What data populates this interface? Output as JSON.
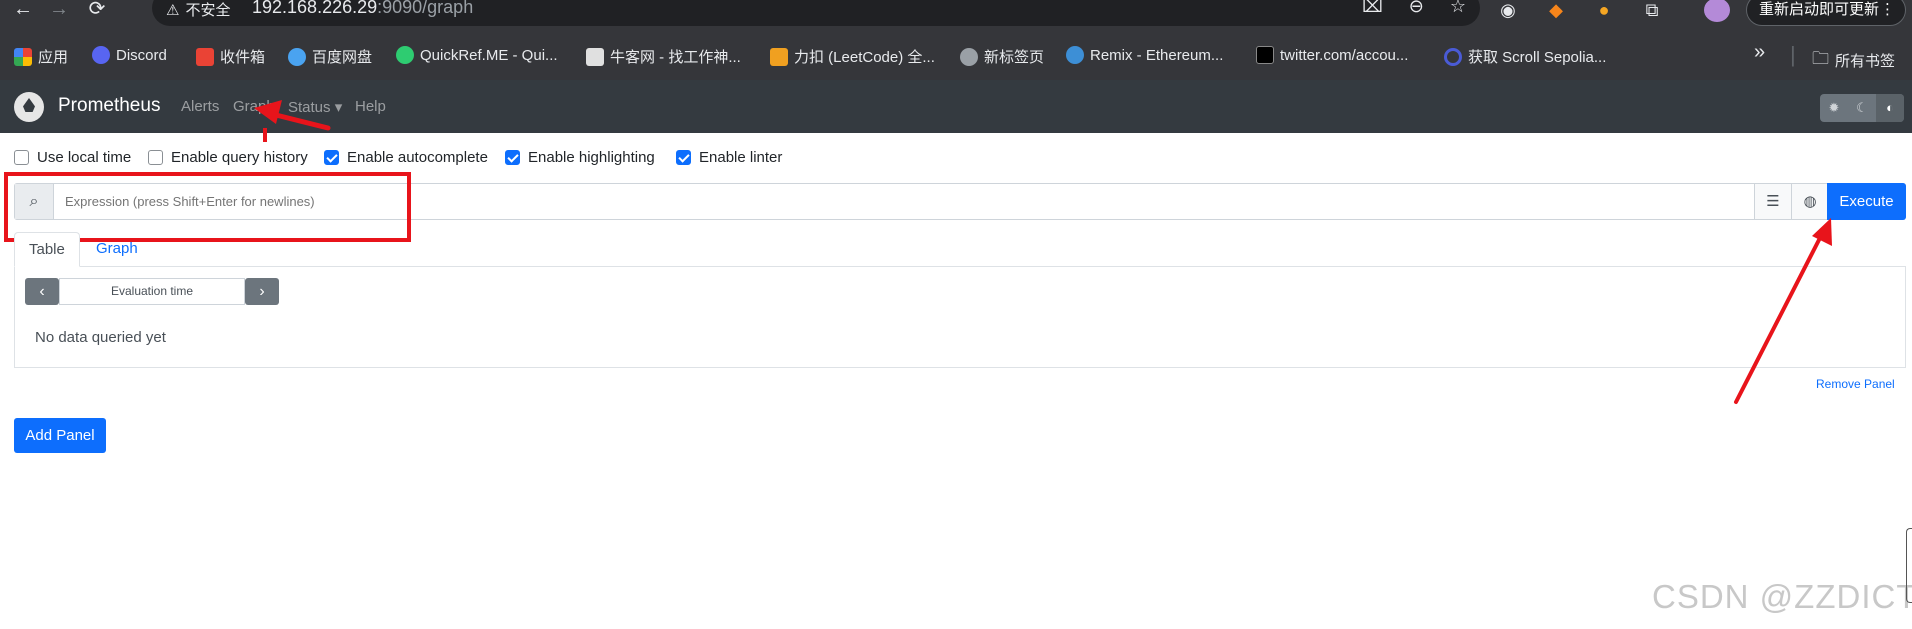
{
  "browser": {
    "security_label": "不安全",
    "url_host": "192.168.226.29",
    "url_rest": ":9090/graph",
    "update_label": "重新启动即可更新",
    "menu_glyph": "⋮",
    "bookmarks": [
      {
        "label": "应用",
        "icon_color": "#ea4335"
      },
      {
        "label": "Discord",
        "icon_color": "#5865f2"
      },
      {
        "label": "收件箱",
        "icon_color": "#ea4335"
      },
      {
        "label": "百度网盘",
        "icon_color": "#4aa3f0"
      },
      {
        "label": "QuickRef.ME - Qui...",
        "icon_color": "#2ecc71"
      },
      {
        "label": "牛客网 - 找工作神...",
        "icon_color": "#e0e0e0"
      },
      {
        "label": "力扣 (LeetCode) 全...",
        "icon_color": "#f0a020"
      },
      {
        "label": "新标签页",
        "icon_color": "#9aa0a6"
      },
      {
        "label": "Remix - Ethereum...",
        "icon_color": "#3d8fd6"
      },
      {
        "label": "twitter.com/accou...",
        "icon_color": "#000000"
      },
      {
        "label": "获取 Scroll Sepolia...",
        "icon_color": "#4a5bd6"
      }
    ],
    "more_glyph": "»",
    "all_bookmarks": "所有书签"
  },
  "nav": {
    "brand": "Prometheus",
    "links": [
      "Alerts",
      "Graph",
      "Status ▾",
      "Help"
    ]
  },
  "options": [
    {
      "label": "Use local time",
      "checked": false
    },
    {
      "label": "Enable query history",
      "checked": false
    },
    {
      "label": "Enable autocomplete",
      "checked": true
    },
    {
      "label": "Enable highlighting",
      "checked": true
    },
    {
      "label": "Enable linter",
      "checked": true
    }
  ],
  "expression": {
    "placeholder": "Expression (press Shift+Enter for newlines)",
    "value": "",
    "execute_label": "Execute"
  },
  "panel": {
    "tabs": [
      "Table",
      "Graph"
    ],
    "active_tab": "Table",
    "eval_placeholder": "Evaluation time",
    "empty_message": "No data queried yet",
    "remove_label": "Remove Panel"
  },
  "add_panel_label": "Add Panel",
  "watermark": "CSDN @ZZDICT",
  "colors": {
    "accent": "#0d6efd",
    "nav_bg": "#343a40",
    "annotation": "#e8141b"
  }
}
